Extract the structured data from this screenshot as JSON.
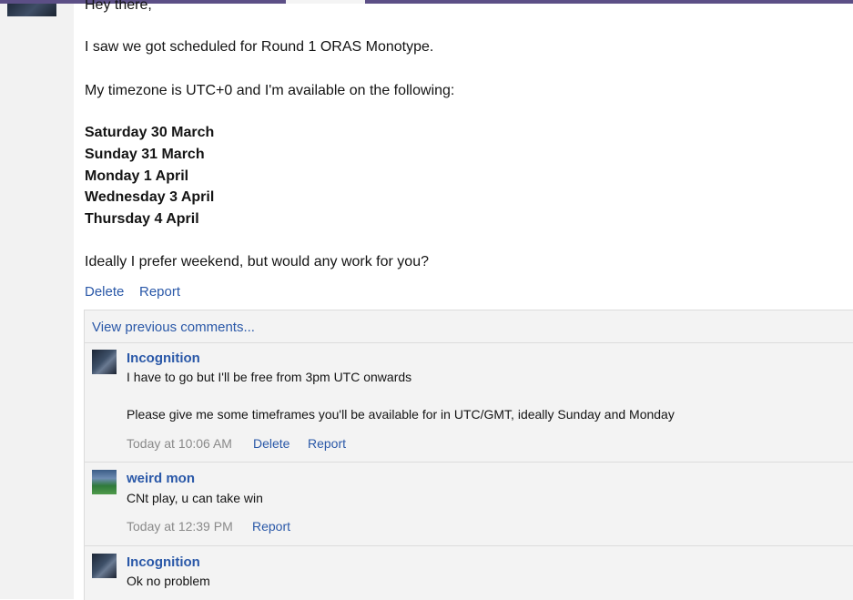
{
  "post": {
    "greeting": "Hey there,",
    "line1": "I saw we got scheduled for Round 1 ORAS Monotype.",
    "line2": "My timezone is UTC+0 and I'm available on the following:",
    "dates": [
      "Saturday 30 March",
      "Sunday 31 March",
      "Monday 1 April",
      "Wednesday 3 April",
      "Thursday 4 April"
    ],
    "closing": "Ideally I prefer weekend, but would any work for you?",
    "delete_label": "Delete",
    "report_label": "Report"
  },
  "comments": {
    "view_previous": "View previous comments...",
    "items": [
      {
        "author": "Incognition",
        "text1": "I have to go but I'll be free from 3pm UTC onwards",
        "text2": "Please give me some timeframes you'll be available for in UTC/GMT, ideally Sunday and Monday",
        "time": "Today at 10:06 AM",
        "delete_label": "Delete",
        "report_label": "Report"
      },
      {
        "author": "weird mon",
        "text1": "CNt play, u can take win",
        "time": "Today at 12:39 PM",
        "report_label": "Report"
      },
      {
        "author": "Incognition",
        "text1": "Ok no problem"
      }
    ]
  },
  "colors": {
    "link": "#2a58a8",
    "topbar": "#5c4f86",
    "muted_text": "#8a8a8a",
    "comment_bg": "#f3f3f3"
  }
}
